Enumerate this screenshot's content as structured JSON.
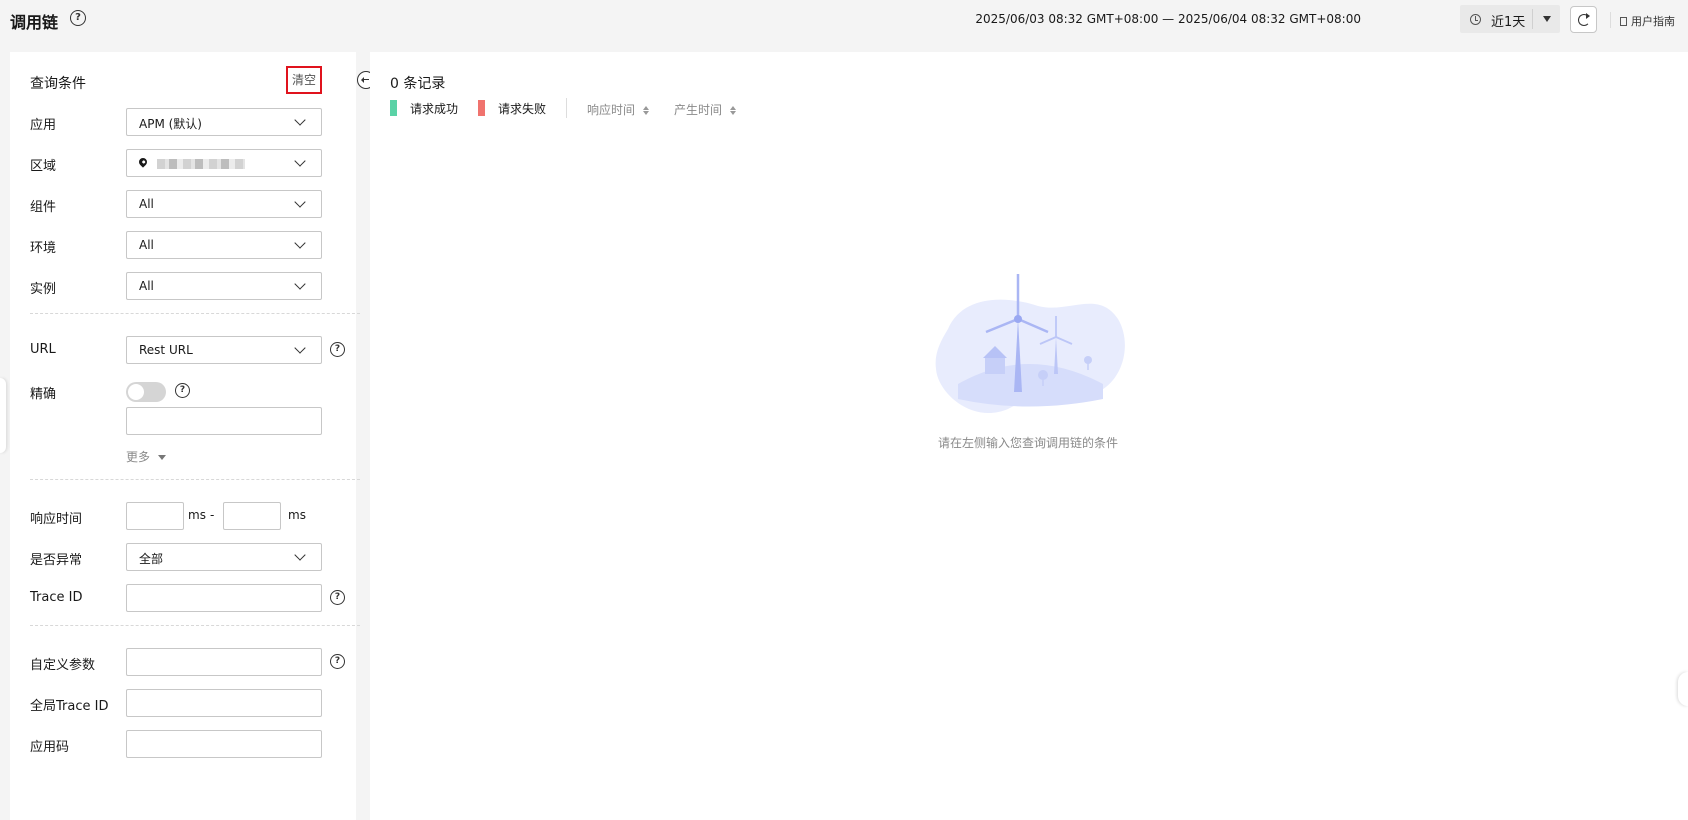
{
  "header": {
    "title": "调用链",
    "help_icon": "question-circle-icon",
    "time_range": "2025/06/03 08:32 GMT+08:00 — 2025/06/04 08:32 GMT+08:00",
    "period_label": "近1天",
    "refresh_icon": "refresh-icon",
    "user_guide": "用户指南"
  },
  "query": {
    "title": "查询条件",
    "clear_label": "清空",
    "fields": {
      "app": {
        "label": "应用",
        "value": "APM (默认)"
      },
      "region": {
        "label": "区域"
      },
      "component": {
        "label": "组件",
        "value": "All"
      },
      "environment": {
        "label": "环境",
        "value": "All"
      },
      "instance": {
        "label": "实例",
        "value": "All"
      },
      "url": {
        "label": "URL",
        "value": "Rest URL"
      },
      "exact": {
        "label": "精确"
      },
      "more": "更多",
      "response_time": {
        "label": "响应时间",
        "unit": "ms",
        "separator": "-"
      },
      "is_error": {
        "label": "是否异常",
        "value": "全部"
      },
      "trace_id": {
        "label": "Trace ID"
      },
      "custom_params": {
        "label": "自定义参数"
      },
      "global_trace_id": {
        "label": "全局Trace ID"
      },
      "app_code": {
        "label": "应用码"
      }
    }
  },
  "results": {
    "count_text": "0 条记录",
    "legend": [
      {
        "label": "请求成功",
        "color": "#5ad2a6"
      },
      {
        "label": "请求失败",
        "color": "#f0736e"
      }
    ],
    "sort": [
      "响应时间",
      "产生时间"
    ],
    "empty_text": "请在左侧输入您查询调用链的条件"
  },
  "colors": {
    "accent_red": "#e0131d",
    "empty_blob": "#e8ecfd",
    "empty_turbine": "#aab6f4"
  }
}
